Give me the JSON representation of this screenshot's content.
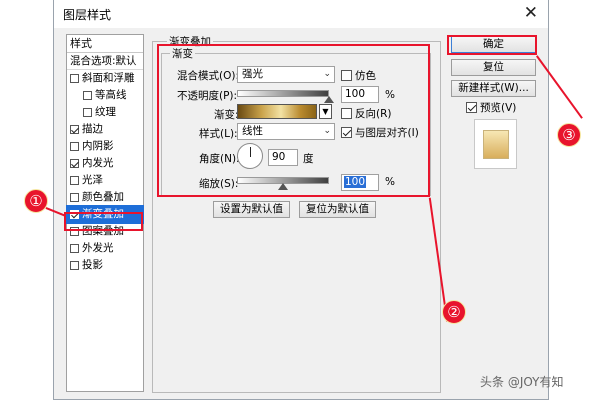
{
  "window": {
    "title": "图层样式",
    "close_glyph": "✕"
  },
  "styles_panel": {
    "header": "样式",
    "blend_default": "混合选项:默认",
    "items": [
      {
        "label": "斜面和浮雕",
        "checked": false,
        "indent": false
      },
      {
        "label": "等高线",
        "checked": false,
        "indent": true
      },
      {
        "label": "纹理",
        "checked": false,
        "indent": true
      },
      {
        "label": "描边",
        "checked": true,
        "indent": false
      },
      {
        "label": "内阴影",
        "checked": false,
        "indent": false
      },
      {
        "label": "内发光",
        "checked": true,
        "indent": false
      },
      {
        "label": "光泽",
        "checked": false,
        "indent": false
      },
      {
        "label": "颜色叠加",
        "checked": false,
        "indent": false
      },
      {
        "label": "渐变叠加",
        "checked": true,
        "indent": false,
        "selected": true
      },
      {
        "label": "图案叠加",
        "checked": false,
        "indent": false
      },
      {
        "label": "外发光",
        "checked": false,
        "indent": false
      },
      {
        "label": "投影",
        "checked": false,
        "indent": false
      }
    ]
  },
  "gradient_overlay": {
    "group_title": "渐变叠加",
    "inner_title": "渐变",
    "blend_mode_label": "混合模式(O):",
    "blend_mode_value": "强光",
    "dither_label": "仿色",
    "dither_checked": false,
    "opacity_label": "不透明度(P):",
    "opacity_value": "100",
    "opacity_unit": "%",
    "opacity_level": 1.0,
    "gradient_label": "渐变:",
    "reverse_label": "反向(R)",
    "reverse_checked": false,
    "style_label": "样式(L):",
    "style_value": "线性",
    "align_label": "与图层对齐(I)",
    "align_checked": true,
    "angle_label": "角度(N):",
    "angle_value": "90",
    "angle_unit": "度",
    "scale_label": "缩放(S):",
    "scale_value": "100",
    "scale_unit": "%",
    "scale_level": 0.5,
    "set_default": "设置为默认值",
    "reset_default": "复位为默认值"
  },
  "right_panel": {
    "ok": "确定",
    "reset": "复位",
    "new_style": "新建样式(W)...",
    "preview_label": "预览(V)",
    "preview_checked": true
  },
  "annotations": {
    "one": "①",
    "two": "②",
    "three": "③"
  },
  "watermark": "头条 @JOY有知",
  "colors": {
    "highlight_red": "#e8142c",
    "selection_blue": "#1e6ed8"
  }
}
